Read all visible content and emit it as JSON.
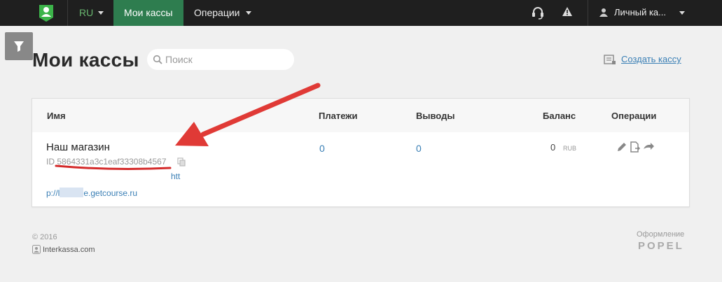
{
  "nav": {
    "lang": "RU",
    "active_item": "Мои кассы",
    "operations": "Операции",
    "account": "Личный ка..."
  },
  "heading": {
    "title": "Мои кассы",
    "search_placeholder": "Поиск",
    "create_label": "Создать кассу"
  },
  "table": {
    "columns": {
      "name": "Имя",
      "payments": "Платежи",
      "withdrawals": "Выводы",
      "balance": "Баланс",
      "operations": "Операции"
    },
    "rows": [
      {
        "name": "Наш магазин",
        "id_label": "ID",
        "id_value": "5864331a3c1eaf33308b4567",
        "link_part1": "htt",
        "link_part2_prefix": "p://l",
        "link_part2_suffix": "e.getcourse.ru",
        "payments": "0",
        "withdrawals": "0",
        "balance": "0",
        "currency": "RUB"
      }
    ]
  },
  "footer": {
    "copyright": "© 2016",
    "company": "Interkassa.com",
    "design_label": "Оформление",
    "design_brand": "POPEL"
  },
  "colors": {
    "topbar": "#1f1f1f",
    "active_nav": "#2e7d4f",
    "link": "#3a7fb5",
    "annotation": "#e03a36"
  },
  "icons": {
    "logo": "user-logo-icon",
    "support": "headset-icon",
    "alert": "warning-icon",
    "user": "user-icon",
    "filter": "filter-icon",
    "search": "search-icon",
    "create": "register-icon",
    "copy": "copy-icon",
    "edit": "pencil-icon",
    "export": "document-export-icon",
    "transfer": "transfer-arrow-icon"
  }
}
